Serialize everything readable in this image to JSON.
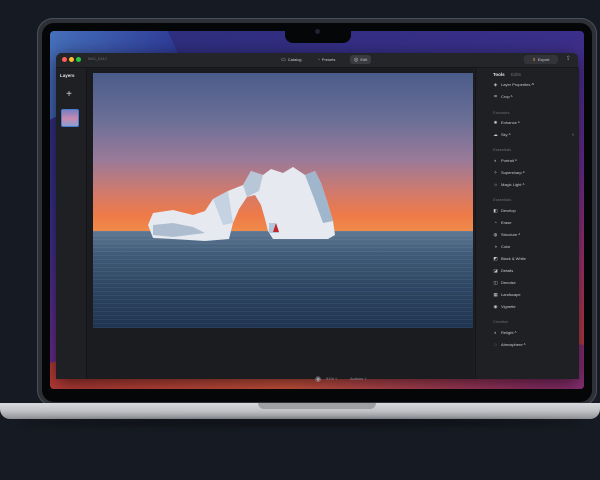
{
  "window": {
    "document_name": "IMG_0142"
  },
  "topbar": {
    "nav": [
      {
        "icon": "catalog-icon",
        "glyph": "▭",
        "label": "Catalog"
      },
      {
        "icon": "presets-icon",
        "glyph": "◦",
        "label": "Presets"
      },
      {
        "icon": "edit-icon",
        "glyph": "◎",
        "label": "Edit",
        "active": true
      }
    ],
    "export_label": "Export"
  },
  "layers": {
    "title": "Layers"
  },
  "canvas_toolbar": {
    "zoom": "91% ˅",
    "mode": "Actions ˅"
  },
  "tools": {
    "tabs": [
      "Tools",
      "Edits"
    ],
    "top_items": [
      {
        "glyph": "◈",
        "label": "Layer Properties ᴬᴵ"
      },
      {
        "glyph": "⌗",
        "label": "Crop ᴬ"
      }
    ],
    "sections": [
      {
        "title": "Favorites",
        "items": [
          {
            "glyph": "✺",
            "label": "Enhance ᴬ"
          },
          {
            "glyph": "☁",
            "label": "Sky ᴬ"
          }
        ]
      },
      {
        "title": "Essentials",
        "items": [
          {
            "glyph": "◐",
            "label": "Portrait ᴬ"
          },
          {
            "glyph": "✧",
            "label": "Supersharp ᴬ"
          },
          {
            "glyph": "☼",
            "label": "Magic Light ᴬ"
          }
        ]
      },
      {
        "title": "Essentials",
        "items": [
          {
            "glyph": "◧",
            "label": "Develop"
          },
          {
            "glyph": "◔",
            "label": "Erase"
          },
          {
            "glyph": "◍",
            "label": "Structure ᴬ"
          },
          {
            "glyph": "◑",
            "label": "Color"
          },
          {
            "glyph": "◩",
            "label": "Black & White"
          },
          {
            "glyph": "◪",
            "label": "Details"
          },
          {
            "glyph": "◫",
            "label": "Denoise"
          },
          {
            "glyph": "▦",
            "label": "Landscape"
          },
          {
            "glyph": "◉",
            "label": "Vignette"
          }
        ]
      },
      {
        "title": "Creative",
        "items": [
          {
            "glyph": "◐",
            "label": "Relight ᴬ"
          },
          {
            "glyph": "◌",
            "label": "Atmosphere ᴬ"
          }
        ]
      }
    ]
  },
  "colors": {
    "accent_orange": "#e0913a",
    "selection_blue": "#4a7bd0",
    "panel_bg": "#1f2024",
    "page_bg": "#161a22"
  }
}
